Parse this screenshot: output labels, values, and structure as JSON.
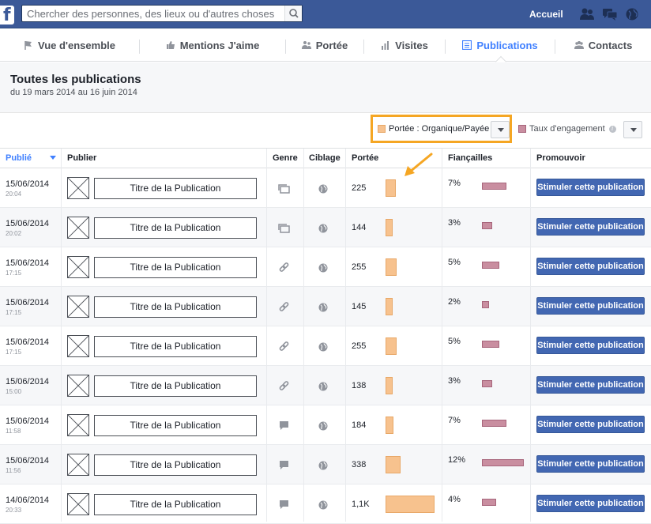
{
  "topbar": {
    "logo": "f",
    "search_placeholder": "Chercher des personnes, des lieux ou d'autres choses",
    "home_label": "Accueil",
    "icons": [
      "friends-icon",
      "messages-icon",
      "notifications-globe-icon"
    ]
  },
  "tabs": [
    {
      "label": "Vue d'ensemble",
      "icon": "flag-icon",
      "active": false
    },
    {
      "label": "Mentions J'aime",
      "icon": "thumb-up-icon",
      "active": false
    },
    {
      "label": "Portée",
      "icon": "people-icon",
      "active": false
    },
    {
      "label": "Visites",
      "icon": "bar-chart-icon",
      "active": false
    },
    {
      "label": "Publications",
      "icon": "list-icon",
      "active": true
    },
    {
      "label": "Contacts",
      "icon": "group-icon",
      "active": false
    }
  ],
  "header": {
    "title": "Toutes les publications",
    "date_range": "du 19 mars 2014 au 16 juin 2014"
  },
  "filters": {
    "reach_label": "Portée : Organique/Payée",
    "engagement_label": "Taux d'engagement",
    "reach_color": "#f7c28e",
    "engagement_color": "#c98ea0"
  },
  "columns": {
    "published": "Publié",
    "post": "Publier",
    "type": "Genre",
    "targeting": "Ciblage",
    "reach": "Portée",
    "engagement": "Fiançailles",
    "promote": "Promouvoir"
  },
  "rows": [
    {
      "date": "15/06/2014",
      "time": "20:04",
      "title": "Titre de la Publication",
      "type": "album",
      "reach": "225",
      "reach_value": 225,
      "engagement": "7%",
      "engagement_value": 7,
      "boost": "Stimuler cette publication"
    },
    {
      "date": "15/06/2014",
      "time": "20:02",
      "title": "Titre de la Publication",
      "type": "album",
      "reach": "144",
      "reach_value": 144,
      "engagement": "3%",
      "engagement_value": 3,
      "boost": "Stimuler cette publication"
    },
    {
      "date": "15/06/2014",
      "time": "17:15",
      "title": "Titre de la Publication",
      "type": "link",
      "reach": "255",
      "reach_value": 255,
      "engagement": "5%",
      "engagement_value": 5,
      "boost": "Stimuler cette publication"
    },
    {
      "date": "15/06/2014",
      "time": "17:15",
      "title": "Titre de la Publication",
      "type": "link",
      "reach": "145",
      "reach_value": 145,
      "engagement": "2%",
      "engagement_value": 2,
      "boost": "Stimuler cette publication"
    },
    {
      "date": "15/06/2014",
      "time": "17:15",
      "title": "Titre de la Publication",
      "type": "link",
      "reach": "255",
      "reach_value": 255,
      "engagement": "5%",
      "engagement_value": 5,
      "boost": "Stimuler cette publication"
    },
    {
      "date": "15/06/2014",
      "time": "15:00",
      "title": "Titre de la Publication",
      "type": "link",
      "reach": "138",
      "reach_value": 138,
      "engagement": "3%",
      "engagement_value": 3,
      "boost": "Stimuler cette publication"
    },
    {
      "date": "15/06/2014",
      "time": "11:58",
      "title": "Titre de la Publication",
      "type": "status",
      "reach": "184",
      "reach_value": 184,
      "engagement": "7%",
      "engagement_value": 7,
      "boost": "Stimuler cette publication"
    },
    {
      "date": "15/06/2014",
      "time": "11:56",
      "title": "Titre de la Publication",
      "type": "status",
      "reach": "338",
      "reach_value": 338,
      "engagement": "12%",
      "engagement_value": 12,
      "boost": "Stimuler cette publication"
    },
    {
      "date": "14/06/2014",
      "time": "20:33",
      "title": "Titre de la Publication",
      "type": "status",
      "reach": "1,1K",
      "reach_value": 1100,
      "engagement": "4%",
      "engagement_value": 4,
      "boost": "Stimuler cette publication"
    }
  ]
}
